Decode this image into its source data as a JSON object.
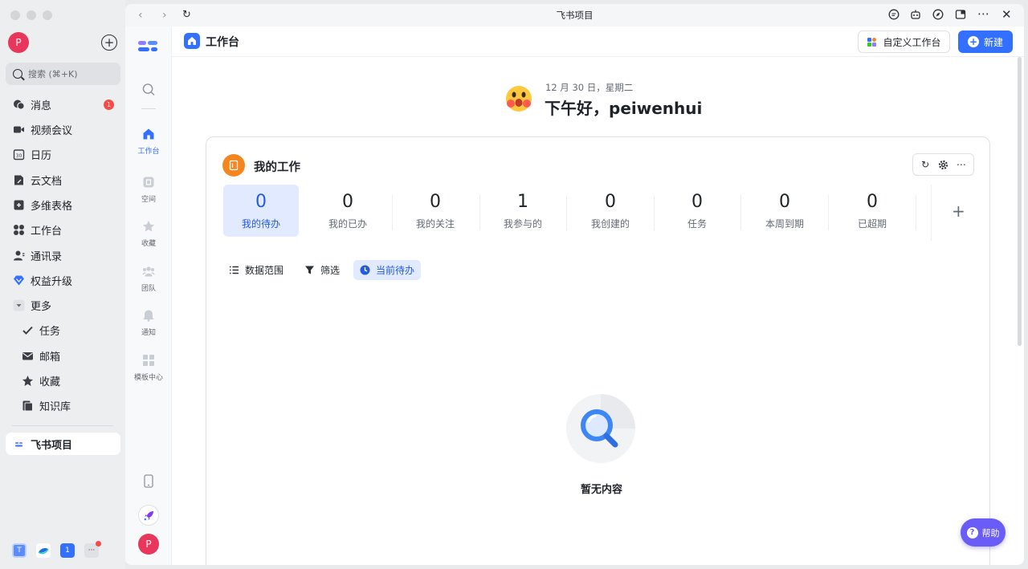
{
  "sidebar": {
    "avatar_initial": "P",
    "search_placeholder": "搜索 (⌘+K)",
    "items": [
      {
        "label": "消息",
        "icon": "message-icon",
        "badge": "1"
      },
      {
        "label": "视频会议",
        "icon": "video-icon"
      },
      {
        "label": "日历",
        "icon": "calendar-icon",
        "icon_text": "30"
      },
      {
        "label": "云文档",
        "icon": "doc-icon"
      },
      {
        "label": "多维表格",
        "icon": "base-icon"
      },
      {
        "label": "工作台",
        "icon": "workplace-icon"
      },
      {
        "label": "通讯录",
        "icon": "contacts-icon"
      },
      {
        "label": "权益升级",
        "icon": "upgrade-icon"
      },
      {
        "label": "更多",
        "icon": "chevron-down-icon"
      },
      {
        "label": "任务",
        "icon": "task-icon"
      },
      {
        "label": "邮箱",
        "icon": "mail-icon"
      },
      {
        "label": "收藏",
        "icon": "star-icon"
      },
      {
        "label": "知识库",
        "icon": "wiki-icon"
      }
    ],
    "active_item": {
      "label": "飞书项目",
      "icon": "project-icon"
    },
    "dock": [
      {
        "icon": "tenant-t-icon",
        "text": "T"
      },
      {
        "icon": "app-icon",
        "text": ""
      },
      {
        "icon": "number-one-icon",
        "text": "1"
      },
      {
        "icon": "more-dots-icon",
        "text": "···"
      }
    ]
  },
  "window": {
    "title": "飞书项目"
  },
  "rail": {
    "items": [
      {
        "label": "工作台",
        "icon": "home-icon",
        "active": true
      },
      {
        "label": "空间",
        "icon": "space-icon"
      },
      {
        "label": "收藏",
        "icon": "star-icon"
      },
      {
        "label": "团队",
        "icon": "team-icon"
      },
      {
        "label": "通知",
        "icon": "bell-icon"
      },
      {
        "label": "模板中心",
        "icon": "template-icon"
      }
    ],
    "avatar_initial": "P"
  },
  "header": {
    "title": "工作台",
    "custom_button": "自定义工作台",
    "new_button": "新建"
  },
  "greeting": {
    "date": "12 月 30 日，星期二",
    "text": "下午好，peiwenhui"
  },
  "card": {
    "title": "我的工作",
    "stats": [
      {
        "value": "0",
        "label": "我的待办",
        "active": true
      },
      {
        "value": "0",
        "label": "我的已办"
      },
      {
        "value": "0",
        "label": "我的关注"
      },
      {
        "value": "1",
        "label": "我参与的"
      },
      {
        "value": "0",
        "label": "我创建的"
      },
      {
        "value": "0",
        "label": "任务"
      },
      {
        "value": "0",
        "label": "本周到期"
      },
      {
        "value": "0",
        "label": "已超期"
      }
    ],
    "add_symbol": "+",
    "filters": [
      {
        "label": "数据范围",
        "icon": "list-icon"
      },
      {
        "label": "筛选",
        "icon": "filter-icon"
      },
      {
        "label": "当前待办",
        "icon": "clock-icon",
        "active": true
      }
    ],
    "empty_text": "暂无内容"
  },
  "help": {
    "label": "帮助"
  },
  "colors": {
    "accent": "#3370ff",
    "help": "#6a5cf6",
    "badge": "#f54a45",
    "card_icon": "#f5861f"
  }
}
